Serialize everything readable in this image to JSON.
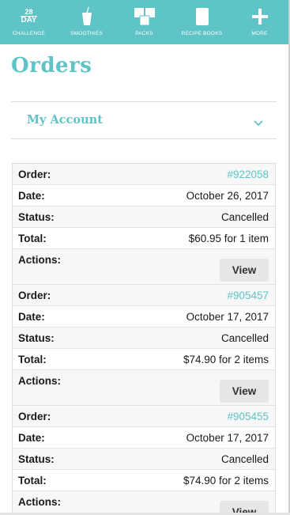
{
  "nav": {
    "logo_top": "28",
    "logo_bottom": "DAY",
    "items": [
      {
        "label": "CHALLENGE",
        "icon": "challenge-logo-icon"
      },
      {
        "label": "SMOOTHIES",
        "icon": "smoothie-cup-icon"
      },
      {
        "label": "PACKS",
        "icon": "packs-icon"
      },
      {
        "label": "RECIPE BOOKS",
        "icon": "book-icon"
      },
      {
        "label": "MORE",
        "icon": "plus-icon"
      }
    ]
  },
  "page": {
    "title": "Orders",
    "account_label": "My Account"
  },
  "labels": {
    "order": "Order:",
    "date": "Date:",
    "status": "Status:",
    "total": "Total:",
    "actions": "Actions:",
    "view": "View"
  },
  "orders": [
    {
      "number": "#922058",
      "date": "October 26, 2017",
      "status": "Cancelled",
      "total": "$60.95 for 1 item"
    },
    {
      "number": "#905457",
      "date": "October 17, 2017",
      "status": "Cancelled",
      "total": "$74.90 for 2 items"
    },
    {
      "number": "#905455",
      "date": "October 17, 2017",
      "status": "Cancelled",
      "total": "$74.90 for 2 items"
    }
  ],
  "colors": {
    "accent": "#5ec4c7",
    "button_bg": "#e6e6e6"
  }
}
